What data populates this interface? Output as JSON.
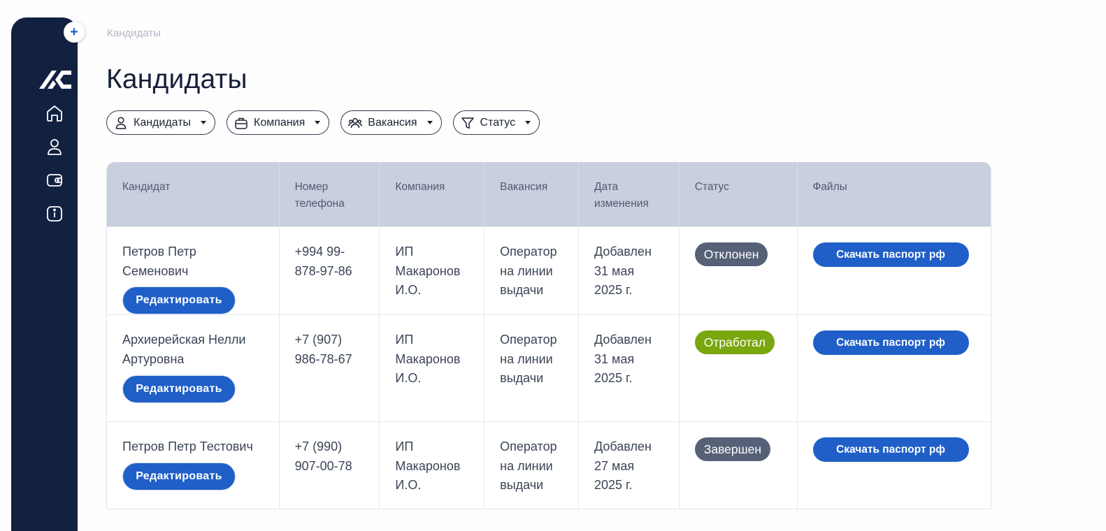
{
  "breadcrumb": "Кандидаты",
  "page_title": "Кандидаты",
  "sidebar": {
    "add_label": "+",
    "icons": [
      "logo-icon",
      "home-icon",
      "user-icon",
      "wallet-icon",
      "info-icon"
    ]
  },
  "filters": [
    {
      "label": "Кандидаты",
      "icon": "user-icon"
    },
    {
      "label": "Компания",
      "icon": "briefcase-icon"
    },
    {
      "label": "Вакансия",
      "icon": "users-icon"
    },
    {
      "label": "Статус",
      "icon": "filter-icon"
    }
  ],
  "table": {
    "headers": [
      "Кандидат",
      "Номер телефона",
      "Компания",
      "Вакансия",
      "Дата изменения",
      "Статус",
      "Файлы"
    ],
    "rows": [
      {
        "name": "Петров Петр Семенович",
        "edit_label": "Редактировать",
        "phone": "+994 99-878-97-86",
        "company": "ИП Макаронов И.О.",
        "vacancy": "Оператор на линии выдачи",
        "date": "Добавлен 31 мая 2025 г.",
        "status": "Отклонен",
        "status_color": "#566178",
        "file_label": "Скачать паспорт рф"
      },
      {
        "name": "Архиерейская Нелли Артуровна",
        "edit_label": "Редактировать",
        "phone": "+7 (907) 986-78-67",
        "company": "ИП Макаронов И.О.",
        "vacancy": "Оператор на линии выдачи",
        "date": "Добавлен 31 мая 2025 г.",
        "status": "Отработал",
        "status_color": "#7aa60f",
        "file_label": "Скачать паспорт рф"
      },
      {
        "name": "Петров Петр Тестович",
        "edit_label": "Редактировать",
        "phone": "+7 (990) 907-00-78",
        "company": "ИП Макаронов И.О.",
        "vacancy": "Оператор на линии выдачи",
        "date": "Добавлен 27 мая 2025 г.",
        "status": "Завершен",
        "status_color": "#566178",
        "file_label": "Скачать паспорт рф"
      }
    ]
  },
  "colors": {
    "sidebar": "#132141",
    "accent": "#1f5fc7",
    "table_header": "#c9cfdf"
  }
}
